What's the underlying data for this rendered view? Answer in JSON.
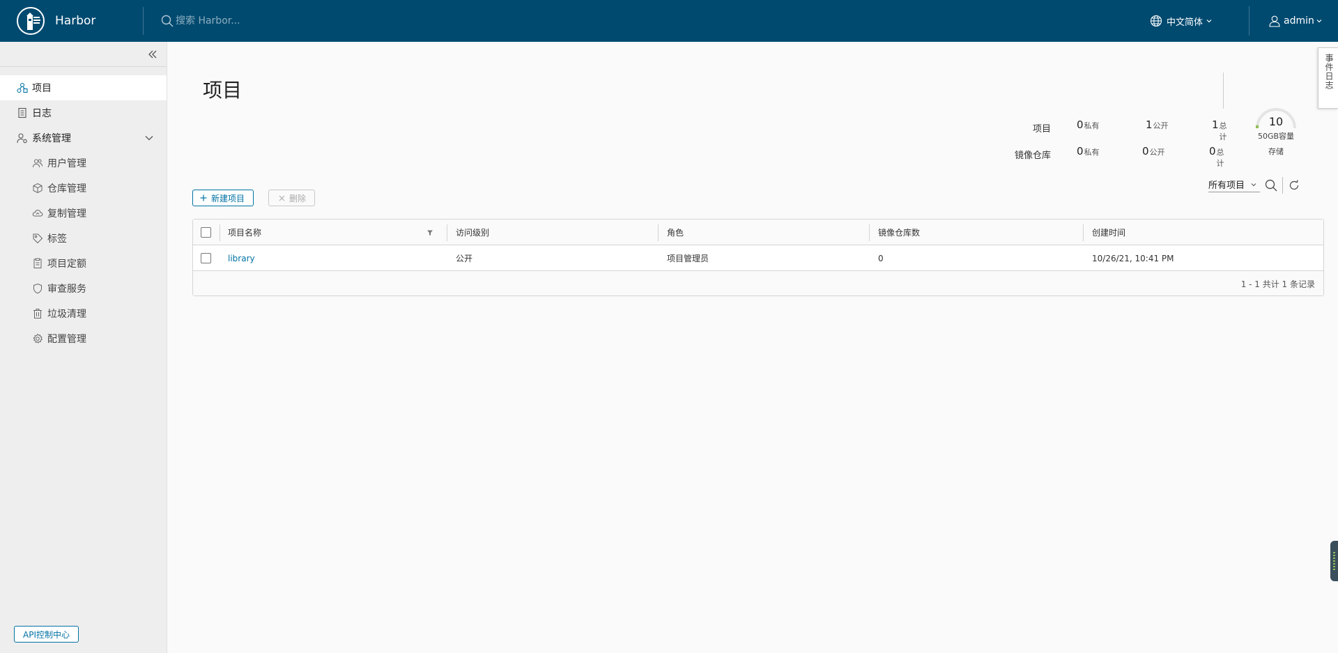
{
  "header": {
    "brand": "Harbor",
    "search_placeholder": "搜索 Harbor...",
    "language": "中文简体",
    "user": "admin"
  },
  "sidebar": {
    "items": [
      {
        "label": "项目",
        "icon": "projects-icon",
        "active": true
      },
      {
        "label": "日志",
        "icon": "logs-icon"
      },
      {
        "label": "系统管理",
        "icon": "admin-icon",
        "expanded": true
      }
    ],
    "subitems": [
      {
        "label": "用户管理",
        "icon": "users-icon"
      },
      {
        "label": "仓库管理",
        "icon": "registry-icon"
      },
      {
        "label": "复制管理",
        "icon": "replication-icon"
      },
      {
        "label": "标签",
        "icon": "tag-icon"
      },
      {
        "label": "项目定额",
        "icon": "quota-icon"
      },
      {
        "label": "审查服务",
        "icon": "shield-icon"
      },
      {
        "label": "垃圾清理",
        "icon": "trash-icon"
      },
      {
        "label": "配置管理",
        "icon": "gear-icon"
      }
    ],
    "api_button": "API控制中心"
  },
  "main": {
    "title": "项目",
    "summary": {
      "rows": [
        {
          "label": "项目",
          "private": "0",
          "public": "1",
          "total": "1"
        },
        {
          "label": "镜像仓库",
          "private": "0",
          "public": "0",
          "total": "0"
        }
      ],
      "units": {
        "private": "私有",
        "public": "公开",
        "total": "总计"
      },
      "storage": {
        "value": "10",
        "capacity": "50GB容量",
        "label": "存储",
        "used_fraction": 0.05
      }
    },
    "actions": {
      "new_project": "新建项目",
      "delete": "删除"
    },
    "filter": {
      "selected": "所有项目"
    },
    "table": {
      "columns": [
        "项目名称",
        "访问级别",
        "角色",
        "镜像仓库数",
        "创建时间"
      ],
      "rows": [
        {
          "name": "library",
          "access": "公开",
          "role": "项目管理员",
          "repo_count": "0",
          "created": "10/26/21, 10:41 PM"
        }
      ],
      "footer": "1 - 1 共计 1 条记录"
    }
  },
  "side_tab": "事件日志",
  "colors": {
    "header": "#004a70",
    "accent": "#0072a3",
    "gauge": "#8fbf5b"
  }
}
